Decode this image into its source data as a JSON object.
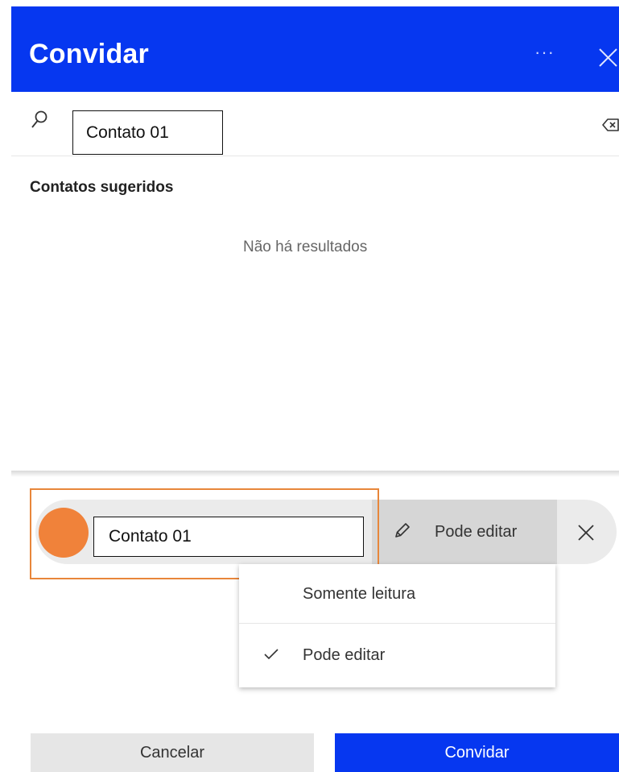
{
  "header": {
    "title": "Convidar",
    "more_label": "···",
    "color": "#0637f0"
  },
  "search": {
    "value": "Contato 01",
    "icon": "search-icon",
    "clear_icon": "backspace-icon"
  },
  "suggestions": {
    "title": "Contatos sugeridos",
    "empty_text": "Não há resultados"
  },
  "invitee": {
    "name": "Contato 01",
    "avatar_color": "#f0823a",
    "permission": "Pode editar",
    "permission_icon": "pencil-icon",
    "remove_icon": "close-icon"
  },
  "permission_menu": {
    "options": [
      {
        "label": "Somente leitura",
        "selected": false
      },
      {
        "label": "Pode editar",
        "selected": true
      }
    ]
  },
  "footer": {
    "cancel_label": "Cancelar",
    "invite_label": "Convidar"
  }
}
